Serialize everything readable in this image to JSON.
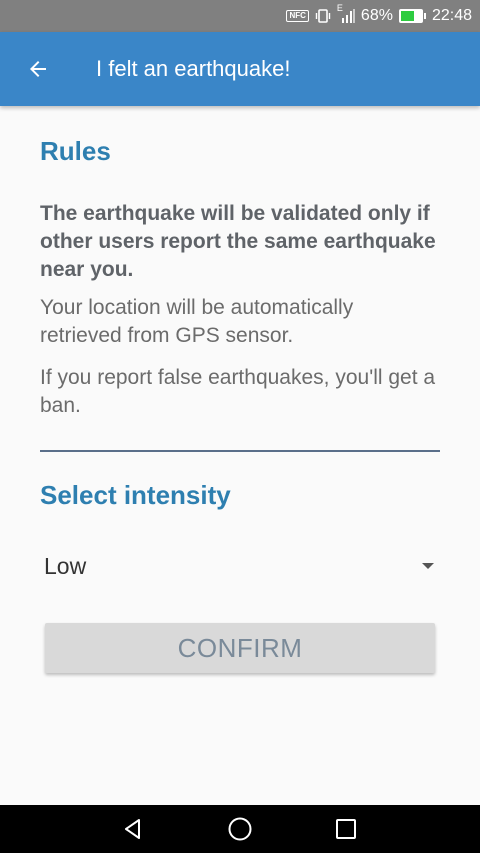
{
  "status_bar": {
    "nfc_label": "NFC",
    "network_label": "E",
    "battery_percent": "68%",
    "battery_level": 0.68,
    "time": "22:48"
  },
  "app_bar": {
    "title": "I felt an earthquake!",
    "back_icon": "arrow-left-icon"
  },
  "rules": {
    "title": "Rules",
    "validation_notice": "The earthquake will be validated only if other users report the same earthquake near you.",
    "location_notice": "Your location will be automatically retrieved from GPS sensor.",
    "ban_notice": "If you report false earthquakes, you'll get a ban."
  },
  "intensity": {
    "title": "Select intensity",
    "selected": "Low"
  },
  "confirm_label": "CONFIRM",
  "colors": {
    "app_bar": "#3a86c8",
    "section_title": "#2e7fb0",
    "button_bg": "#d9d9d9"
  }
}
